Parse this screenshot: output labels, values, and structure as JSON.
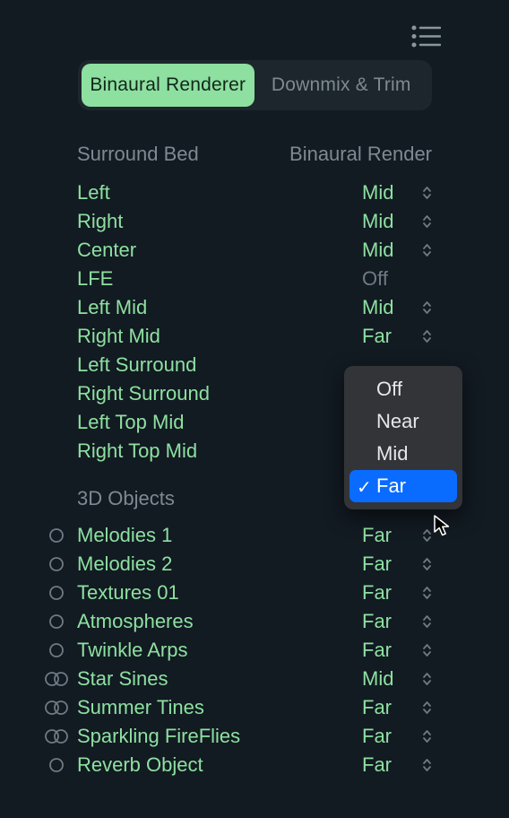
{
  "topbar": {
    "icon": "list"
  },
  "tabs": {
    "active": "Binaural Renderer",
    "idle": "Downmix & Trim"
  },
  "columns": {
    "left": "Surround Bed",
    "right": "Binaural Render"
  },
  "surround_bed": [
    {
      "label": "Left",
      "value": "Mid",
      "muted": false,
      "caret": true
    },
    {
      "label": "Right",
      "value": "Mid",
      "muted": false,
      "caret": true
    },
    {
      "label": "Center",
      "value": "Mid",
      "muted": false,
      "caret": true
    },
    {
      "label": "LFE",
      "value": "Off",
      "muted": true,
      "caret": false
    },
    {
      "label": "Left Mid",
      "value": "Mid",
      "muted": false,
      "caret": true
    },
    {
      "label": "Right Mid",
      "value": "Far",
      "muted": false,
      "caret": true
    },
    {
      "label": "Left Surround",
      "value": "",
      "muted": false,
      "caret": false
    },
    {
      "label": "Right Surround",
      "value": "",
      "muted": false,
      "caret": false
    },
    {
      "label": "Left Top Mid",
      "value": "",
      "muted": false,
      "caret": false
    },
    {
      "label": "Right Top Mid",
      "value": "",
      "muted": false,
      "caret": false
    }
  ],
  "objects_section": {
    "title": "3D Objects"
  },
  "objects": [
    {
      "icon": "mono",
      "label": "Melodies 1",
      "value": "Far"
    },
    {
      "icon": "mono",
      "label": "Melodies 2",
      "value": "Far"
    },
    {
      "icon": "mono",
      "label": "Textures 01",
      "value": "Far"
    },
    {
      "icon": "mono",
      "label": "Atmospheres",
      "value": "Far"
    },
    {
      "icon": "mono",
      "label": "Twinkle Arps",
      "value": "Far"
    },
    {
      "icon": "stereo",
      "label": "Star Sines",
      "value": "Mid"
    },
    {
      "icon": "stereo",
      "label": "Summer Tines",
      "value": "Far"
    },
    {
      "icon": "stereo",
      "label": "Sparkling FireFlies",
      "value": "Far"
    },
    {
      "icon": "mono",
      "label": "Reverb Object",
      "value": "Far"
    }
  ],
  "popover": {
    "options": [
      "Off",
      "Near",
      "Mid",
      "Far"
    ],
    "selected": "Far"
  }
}
